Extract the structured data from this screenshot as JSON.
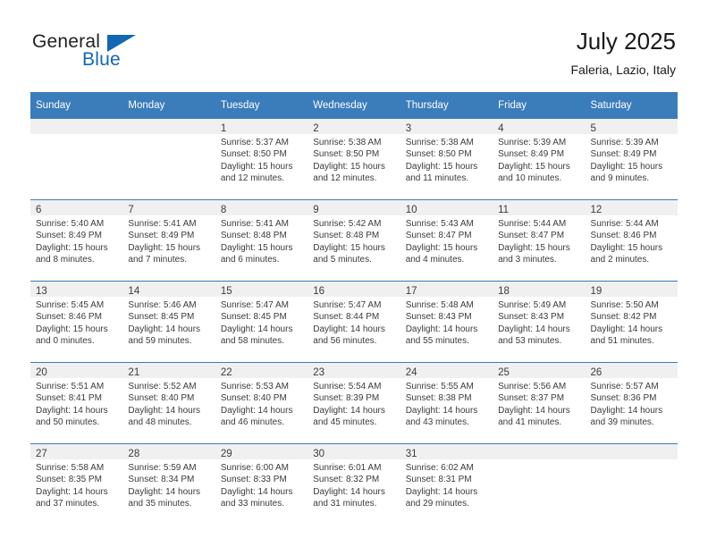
{
  "brand": {
    "name_top": "General",
    "name_bottom": "Blue",
    "triangle_icon": "triangle-icon",
    "accent_color": "#1267b2"
  },
  "header": {
    "title": "July 2025",
    "subtitle": "Faleria, Lazio, Italy"
  },
  "theme": {
    "header_blue": "#3b7cbb",
    "daynum_band": "#f0f0f0",
    "text": "#3b3b3b"
  },
  "calendar": {
    "weekday_headers": [
      "Sunday",
      "Monday",
      "Tuesday",
      "Wednesday",
      "Thursday",
      "Friday",
      "Saturday"
    ],
    "weeks": [
      [
        {
          "day": "",
          "lines": []
        },
        {
          "day": "",
          "lines": []
        },
        {
          "day": "1",
          "lines": [
            "Sunrise: 5:37 AM",
            "Sunset: 8:50 PM",
            "Daylight: 15 hours",
            "and 12 minutes."
          ]
        },
        {
          "day": "2",
          "lines": [
            "Sunrise: 5:38 AM",
            "Sunset: 8:50 PM",
            "Daylight: 15 hours",
            "and 12 minutes."
          ]
        },
        {
          "day": "3",
          "lines": [
            "Sunrise: 5:38 AM",
            "Sunset: 8:50 PM",
            "Daylight: 15 hours",
            "and 11 minutes."
          ]
        },
        {
          "day": "4",
          "lines": [
            "Sunrise: 5:39 AM",
            "Sunset: 8:49 PM",
            "Daylight: 15 hours",
            "and 10 minutes."
          ]
        },
        {
          "day": "5",
          "lines": [
            "Sunrise: 5:39 AM",
            "Sunset: 8:49 PM",
            "Daylight: 15 hours",
            "and 9 minutes."
          ]
        }
      ],
      [
        {
          "day": "6",
          "lines": [
            "Sunrise: 5:40 AM",
            "Sunset: 8:49 PM",
            "Daylight: 15 hours",
            "and 8 minutes."
          ]
        },
        {
          "day": "7",
          "lines": [
            "Sunrise: 5:41 AM",
            "Sunset: 8:49 PM",
            "Daylight: 15 hours",
            "and 7 minutes."
          ]
        },
        {
          "day": "8",
          "lines": [
            "Sunrise: 5:41 AM",
            "Sunset: 8:48 PM",
            "Daylight: 15 hours",
            "and 6 minutes."
          ]
        },
        {
          "day": "9",
          "lines": [
            "Sunrise: 5:42 AM",
            "Sunset: 8:48 PM",
            "Daylight: 15 hours",
            "and 5 minutes."
          ]
        },
        {
          "day": "10",
          "lines": [
            "Sunrise: 5:43 AM",
            "Sunset: 8:47 PM",
            "Daylight: 15 hours",
            "and 4 minutes."
          ]
        },
        {
          "day": "11",
          "lines": [
            "Sunrise: 5:44 AM",
            "Sunset: 8:47 PM",
            "Daylight: 15 hours",
            "and 3 minutes."
          ]
        },
        {
          "day": "12",
          "lines": [
            "Sunrise: 5:44 AM",
            "Sunset: 8:46 PM",
            "Daylight: 15 hours",
            "and 2 minutes."
          ]
        }
      ],
      [
        {
          "day": "13",
          "lines": [
            "Sunrise: 5:45 AM",
            "Sunset: 8:46 PM",
            "Daylight: 15 hours",
            "and 0 minutes."
          ]
        },
        {
          "day": "14",
          "lines": [
            "Sunrise: 5:46 AM",
            "Sunset: 8:45 PM",
            "Daylight: 14 hours",
            "and 59 minutes."
          ]
        },
        {
          "day": "15",
          "lines": [
            "Sunrise: 5:47 AM",
            "Sunset: 8:45 PM",
            "Daylight: 14 hours",
            "and 58 minutes."
          ]
        },
        {
          "day": "16",
          "lines": [
            "Sunrise: 5:47 AM",
            "Sunset: 8:44 PM",
            "Daylight: 14 hours",
            "and 56 minutes."
          ]
        },
        {
          "day": "17",
          "lines": [
            "Sunrise: 5:48 AM",
            "Sunset: 8:43 PM",
            "Daylight: 14 hours",
            "and 55 minutes."
          ]
        },
        {
          "day": "18",
          "lines": [
            "Sunrise: 5:49 AM",
            "Sunset: 8:43 PM",
            "Daylight: 14 hours",
            "and 53 minutes."
          ]
        },
        {
          "day": "19",
          "lines": [
            "Sunrise: 5:50 AM",
            "Sunset: 8:42 PM",
            "Daylight: 14 hours",
            "and 51 minutes."
          ]
        }
      ],
      [
        {
          "day": "20",
          "lines": [
            "Sunrise: 5:51 AM",
            "Sunset: 8:41 PM",
            "Daylight: 14 hours",
            "and 50 minutes."
          ]
        },
        {
          "day": "21",
          "lines": [
            "Sunrise: 5:52 AM",
            "Sunset: 8:40 PM",
            "Daylight: 14 hours",
            "and 48 minutes."
          ]
        },
        {
          "day": "22",
          "lines": [
            "Sunrise: 5:53 AM",
            "Sunset: 8:40 PM",
            "Daylight: 14 hours",
            "and 46 minutes."
          ]
        },
        {
          "day": "23",
          "lines": [
            "Sunrise: 5:54 AM",
            "Sunset: 8:39 PM",
            "Daylight: 14 hours",
            "and 45 minutes."
          ]
        },
        {
          "day": "24",
          "lines": [
            "Sunrise: 5:55 AM",
            "Sunset: 8:38 PM",
            "Daylight: 14 hours",
            "and 43 minutes."
          ]
        },
        {
          "day": "25",
          "lines": [
            "Sunrise: 5:56 AM",
            "Sunset: 8:37 PM",
            "Daylight: 14 hours",
            "and 41 minutes."
          ]
        },
        {
          "day": "26",
          "lines": [
            "Sunrise: 5:57 AM",
            "Sunset: 8:36 PM",
            "Daylight: 14 hours",
            "and 39 minutes."
          ]
        }
      ],
      [
        {
          "day": "27",
          "lines": [
            "Sunrise: 5:58 AM",
            "Sunset: 8:35 PM",
            "Daylight: 14 hours",
            "and 37 minutes."
          ]
        },
        {
          "day": "28",
          "lines": [
            "Sunrise: 5:59 AM",
            "Sunset: 8:34 PM",
            "Daylight: 14 hours",
            "and 35 minutes."
          ]
        },
        {
          "day": "29",
          "lines": [
            "Sunrise: 6:00 AM",
            "Sunset: 8:33 PM",
            "Daylight: 14 hours",
            "and 33 minutes."
          ]
        },
        {
          "day": "30",
          "lines": [
            "Sunrise: 6:01 AM",
            "Sunset: 8:32 PM",
            "Daylight: 14 hours",
            "and 31 minutes."
          ]
        },
        {
          "day": "31",
          "lines": [
            "Sunrise: 6:02 AM",
            "Sunset: 8:31 PM",
            "Daylight: 14 hours",
            "and 29 minutes."
          ]
        },
        {
          "day": "",
          "lines": []
        },
        {
          "day": "",
          "lines": []
        }
      ]
    ]
  }
}
